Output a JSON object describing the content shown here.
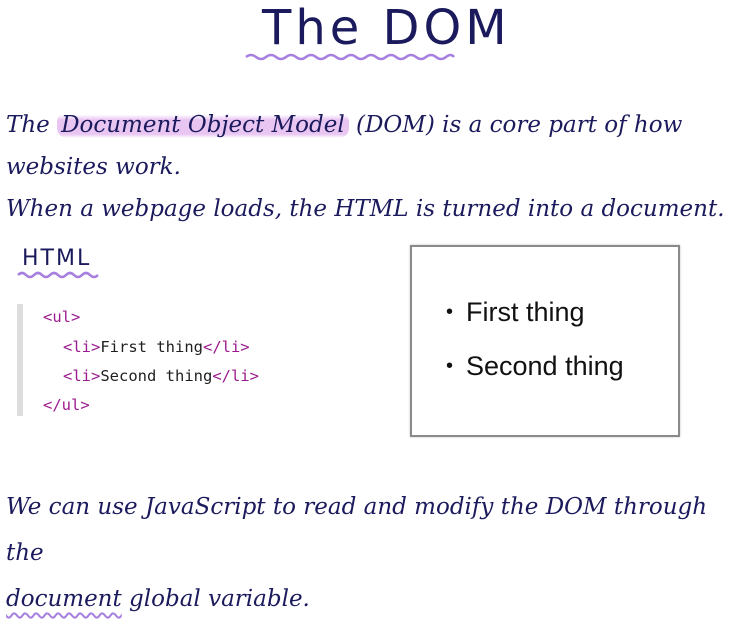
{
  "title": "The DOM",
  "intro": {
    "before": "The ",
    "highlighted": "Document Object Model",
    "after": " (DOM) is a core part of how websites work.",
    "line2": "When a webpage loads, the HTML is turned into a document."
  },
  "code_section": {
    "label": "HTML",
    "lines": [
      {
        "open": "<ul>",
        "text": "",
        "close": ""
      },
      {
        "open": "<li>",
        "text": "First thing",
        "close": "</li>"
      },
      {
        "open": "<li>",
        "text": "Second thing",
        "close": "</li>"
      },
      {
        "open": "</ul>",
        "text": "",
        "close": ""
      }
    ]
  },
  "preview": {
    "items": [
      "First thing",
      "Second thing"
    ]
  },
  "closing": {
    "before": "We can use JavaScript to read and modify the DOM through the",
    "underlined": "document",
    "after": " global variable."
  },
  "colors": {
    "ink": "#1b1a5c",
    "highlight": "#e2b2ee",
    "underline": "#a77fe0",
    "code_tag": "#9c1b8e"
  }
}
